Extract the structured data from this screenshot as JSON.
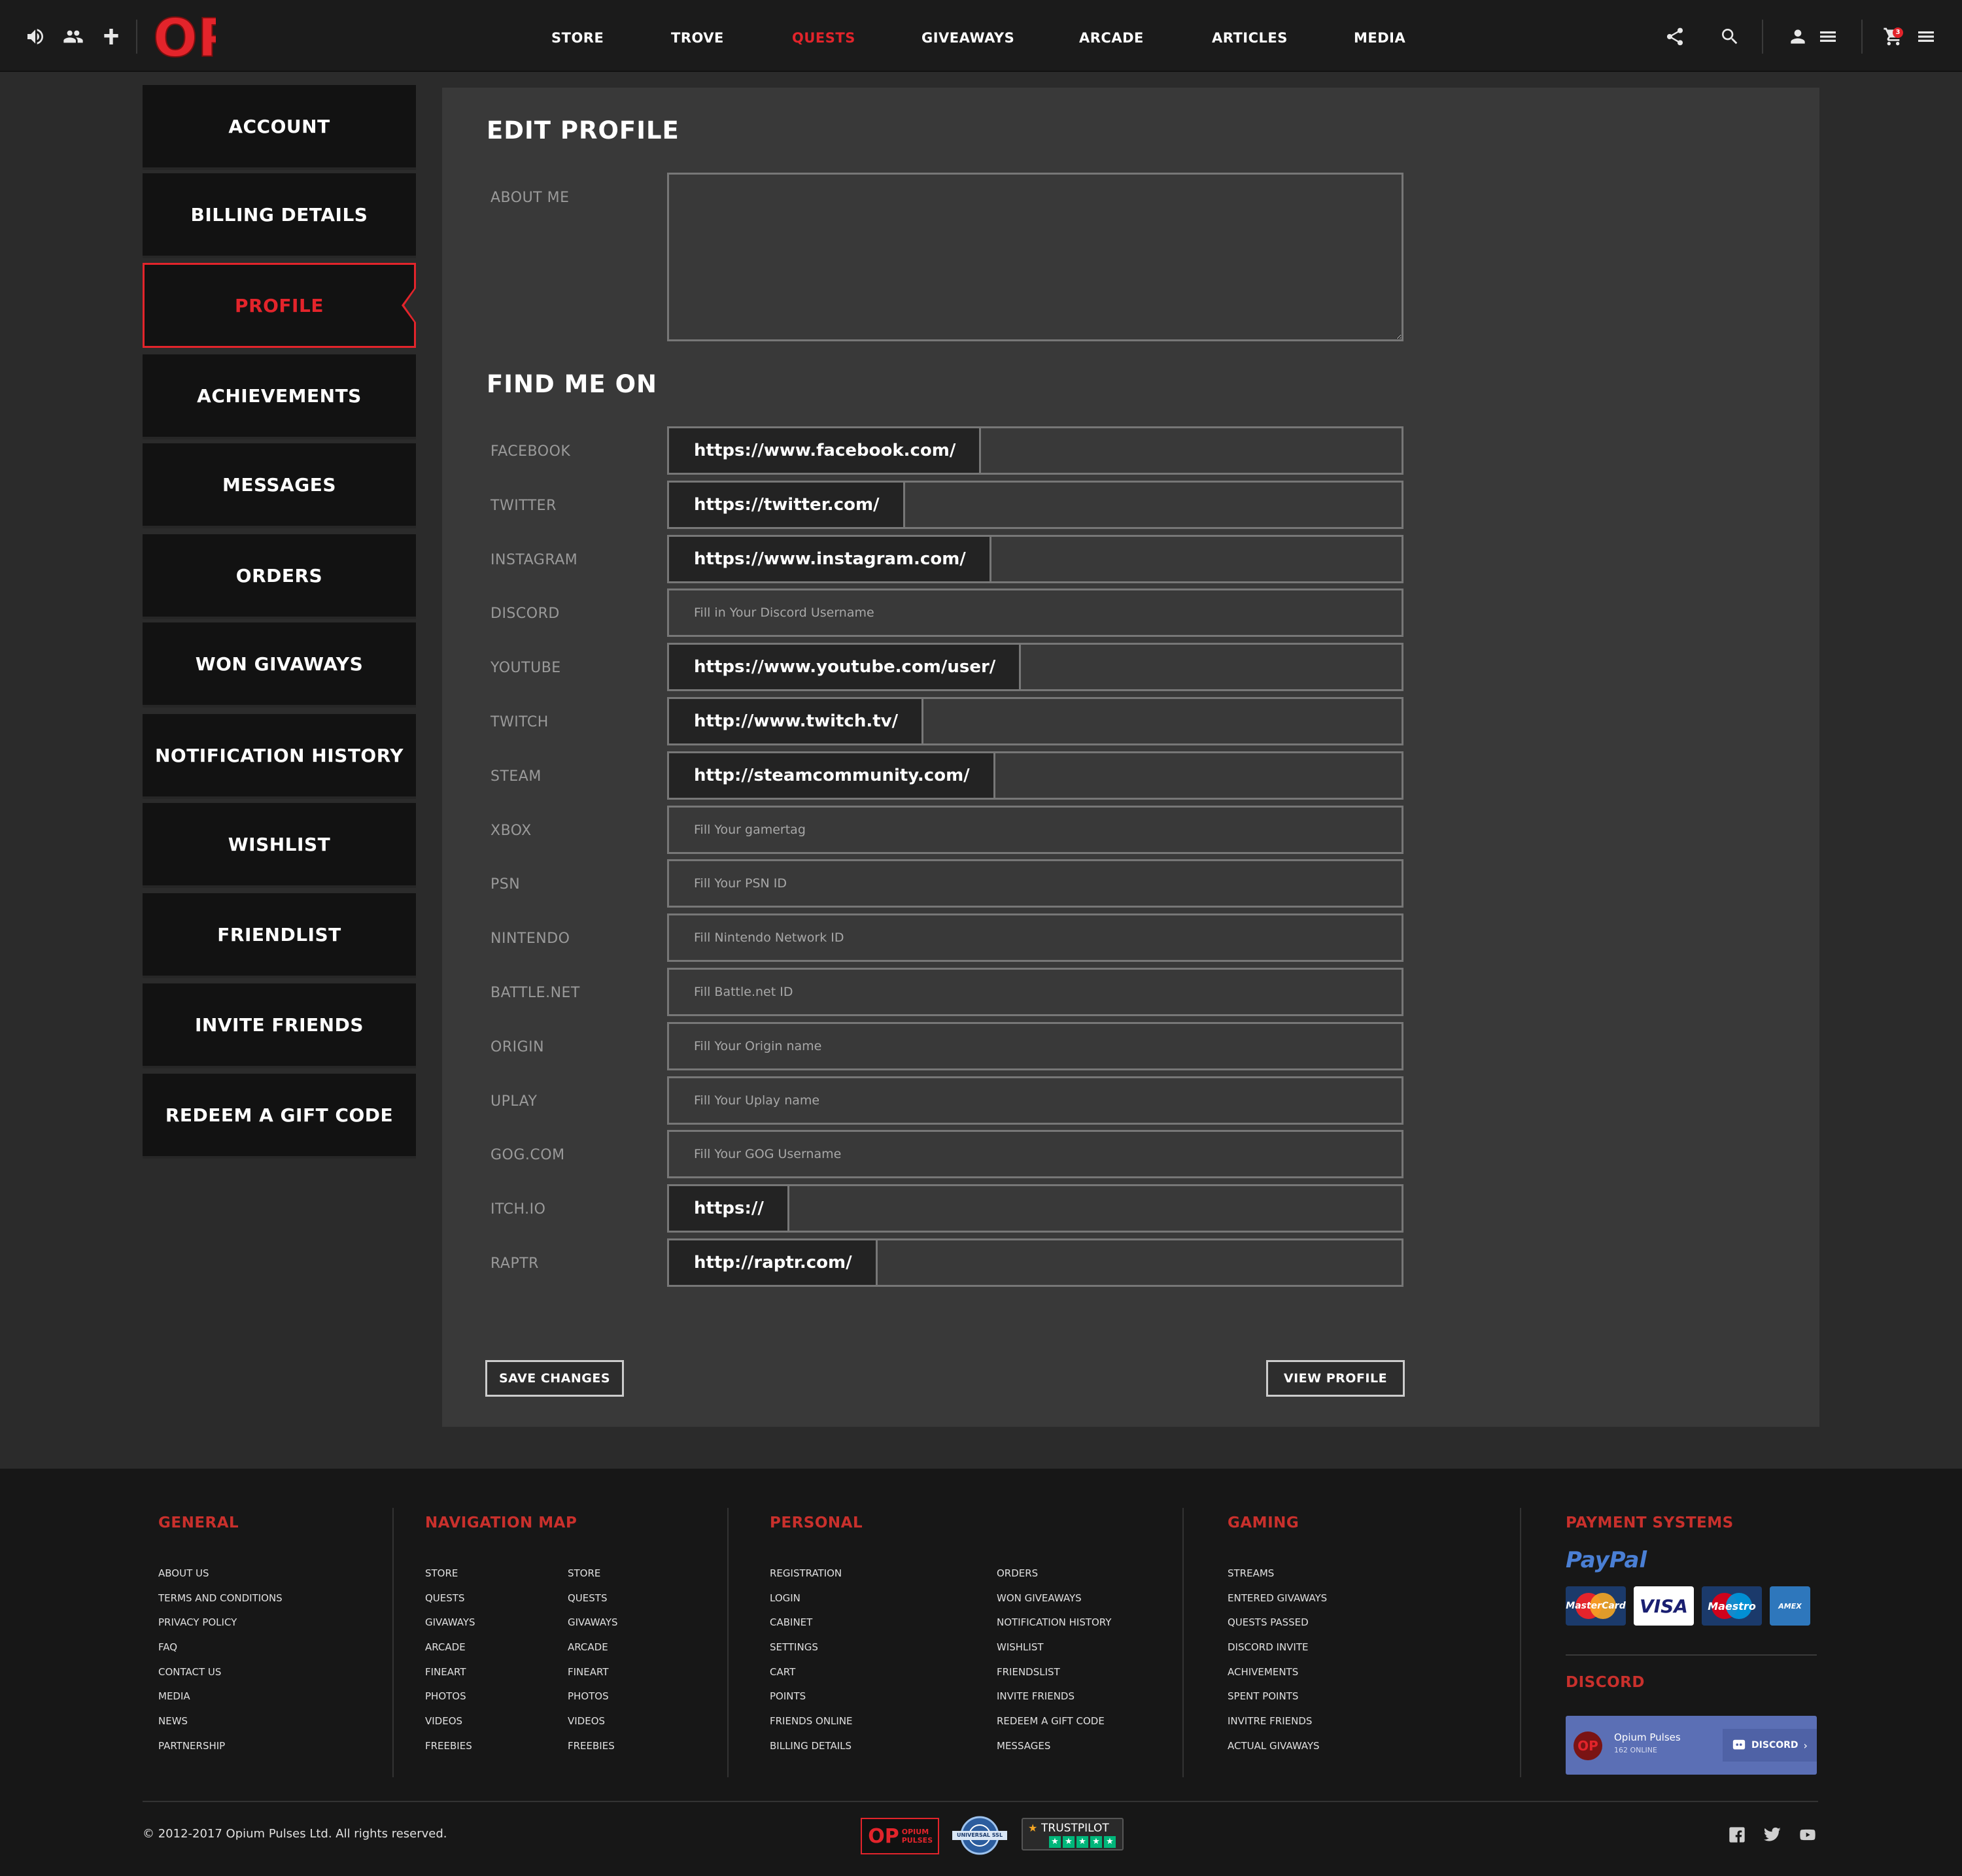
{
  "header": {
    "logo_text": "OP",
    "nav": [
      "STORE",
      "TROVE",
      "QUESTS",
      "GIVEAWAYS",
      "ARCADE",
      "ARTICLES",
      "MEDIA"
    ],
    "active_nav": "QUESTS",
    "cart_count": "3",
    "accent": "#e3242b"
  },
  "sidebar": {
    "items": [
      "ACCOUNT",
      "BILLING DETAILS",
      "PROFILE",
      "ACHIEVEMENTS",
      "MESSAGES",
      "ORDERS",
      "WON GIVAWAYS",
      "NOTIFICATION HISTORY",
      "WISHLIST",
      "FRIENDLIST",
      "INVITE FRIENDS",
      "REDEEM A GIFT CODE"
    ],
    "active": "PROFILE"
  },
  "main": {
    "title": "EDIT PROFILE",
    "about_label": "ABOUT ME",
    "about_value": "",
    "find_title": "FIND ME ON",
    "fields": [
      {
        "label": "FACEBOOK",
        "prefix": "https://www.facebook.com/",
        "value": "",
        "placeholder": ""
      },
      {
        "label": "TWITTER",
        "prefix": "https://twitter.com/",
        "value": "",
        "placeholder": ""
      },
      {
        "label": "INSTAGRAM",
        "prefix": "https://www.instagram.com/",
        "value": "",
        "placeholder": ""
      },
      {
        "label": "DISCORD",
        "prefix": "",
        "value": "",
        "placeholder": "Fill in Your Discord Username"
      },
      {
        "label": "YOUTUBE",
        "prefix": "https://www.youtube.com/user/",
        "value": "",
        "placeholder": ""
      },
      {
        "label": "TWITCH",
        "prefix": "http://www.twitch.tv/",
        "value": "",
        "placeholder": ""
      },
      {
        "label": "STEAM",
        "prefix": "http://steamcommunity.com/",
        "value": "",
        "placeholder": ""
      },
      {
        "label": "XBOX",
        "prefix": "",
        "value": "",
        "placeholder": "Fill Your gamertag"
      },
      {
        "label": "PSN",
        "prefix": "",
        "value": "",
        "placeholder": "Fill Your PSN ID"
      },
      {
        "label": "NINTENDO",
        "prefix": "",
        "value": "",
        "placeholder": "Fill Nintendo Network ID"
      },
      {
        "label": "BATTLE.NET",
        "prefix": "",
        "value": "",
        "placeholder": "Fill Battle.net ID"
      },
      {
        "label": "ORIGIN",
        "prefix": "",
        "value": "",
        "placeholder": "Fill Your Origin name"
      },
      {
        "label": "UPLAY",
        "prefix": "",
        "value": "",
        "placeholder": "Fill Your Uplay name"
      },
      {
        "label": "GOG.COM",
        "prefix": "",
        "value": "",
        "placeholder": "Fill Your GOG Username"
      },
      {
        "label": "ITCH.IO",
        "prefix": "https://",
        "value": "",
        "placeholder": ""
      },
      {
        "label": "RAPTR",
        "prefix": "http://raptr.com/",
        "value": "",
        "placeholder": ""
      }
    ],
    "save_label": "SAVE CHANGES",
    "view_label": "VIEW PROFILE"
  },
  "footer": {
    "general": {
      "title": "GENERAL",
      "links": [
        "ABOUT US",
        "TERMS AND CONDITIONS",
        "PRIVACY POLICY",
        "FAQ",
        "CONTACT US",
        "MEDIA",
        "NEWS",
        "PARTNERSHIP"
      ]
    },
    "navmap": {
      "title": "NAVIGATION MAP",
      "col1": [
        "STORE",
        "QUESTS",
        "GIVAWAYS",
        "ARCADE",
        "FINEART",
        "PHOTOS",
        "VIDEOS",
        "FREEBIES"
      ],
      "col2": [
        "STORE",
        "QUESTS",
        "GIVAWAYS",
        "ARCADE",
        "FINEART",
        "PHOTOS",
        "VIDEOS",
        "FREEBIES"
      ]
    },
    "personal": {
      "title": "PERSONAL",
      "col1": [
        "REGISTRATION",
        "LOGIN",
        "CABINET",
        "SETTINGS",
        "CART",
        "POINTS",
        "FRIENDS ONLINE",
        "BILLING DETAILS"
      ],
      "col2": [
        "ORDERS",
        "WON GIVEAWAYS",
        "NOTIFICATION HISTORY",
        "WISHLIST",
        "FRIENDSLIST",
        "INVITE FRIENDS",
        "REDEEM A GIFT CODE",
        "MESSAGES"
      ]
    },
    "gaming": {
      "title": "GAMING",
      "links": [
        "STREAMS",
        "ENTERED GIVAWAYS",
        "QUESTS PASSED",
        "DISCORD INVITE",
        "ACHIVEMENTS",
        "SPENT POINTS",
        "INVITRE FRIENDS",
        "ACTUAL GIVAWAYS"
      ]
    },
    "payment": {
      "title": "PAYMENT SYSTEMS",
      "paypal": "PayPal",
      "cards": [
        "MasterCard",
        "VISA",
        "Maestro",
        "AMEX"
      ]
    },
    "discord": {
      "title": "DISCORD",
      "server": "Opium Pulses",
      "online": "162 ONLINE",
      "button": "DISCORD"
    },
    "copyright": "© 2012-2017 Opium Pulses Ltd. All rights reserved.",
    "badges": {
      "op": "OPIUM PULSES",
      "ssl": "UNIVERSAL SSL",
      "trustpilot": "TRUSTPILOT"
    }
  }
}
